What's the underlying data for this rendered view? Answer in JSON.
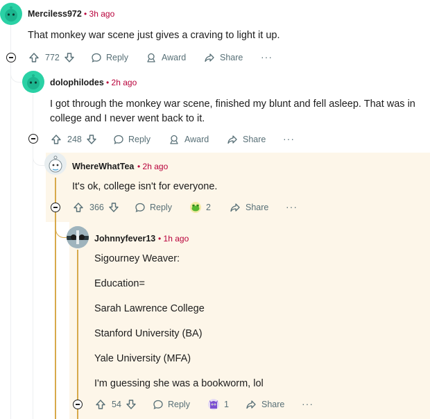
{
  "comments": [
    {
      "username": "Merciless972",
      "time": "3h ago",
      "body": [
        "That monkey war scene just gives a craving to light it up."
      ],
      "votes": "772",
      "reply": "Reply",
      "award": "Award",
      "share": "Share",
      "more": "···"
    },
    {
      "username": "dolophilodes",
      "time": "2h ago",
      "body": [
        "I got through the monkey war scene, finished my blunt and fell asleep. That was in",
        "college and I never went back to it."
      ],
      "votes": "248",
      "reply": "Reply",
      "award": "Award",
      "share": "Share",
      "more": "···"
    },
    {
      "username": "WhereWhatTea",
      "time": "2h ago",
      "body": [
        "It's ok, college isn't for everyone."
      ],
      "votes": "366",
      "reply": "Reply",
      "award_count": "2",
      "share": "Share",
      "more": "···"
    },
    {
      "username": "Johnnyfever13",
      "time": "1h ago",
      "body": [
        "Sigourney Weaver:",
        "Education=",
        "Sarah Lawrence College",
        "Stanford University (BA)",
        "Yale University (MFA)",
        "I'm guessing she was a bookworm, lol"
      ],
      "votes": "54",
      "reply": "Reply",
      "award_count": "1",
      "share": "Share",
      "more": "···"
    }
  ],
  "separator": "•",
  "colors": {
    "time": "#b8003a",
    "highlight_line": "#d7a94a",
    "highlight_bg": "#fdf6e9",
    "avatar_teal": "#2ad1a5"
  },
  "icons": [
    "upvote-icon",
    "downvote-icon",
    "reply-icon",
    "award-icon",
    "share-icon",
    "collapse-icon",
    "award-frog-icon",
    "award-creature-icon"
  ]
}
